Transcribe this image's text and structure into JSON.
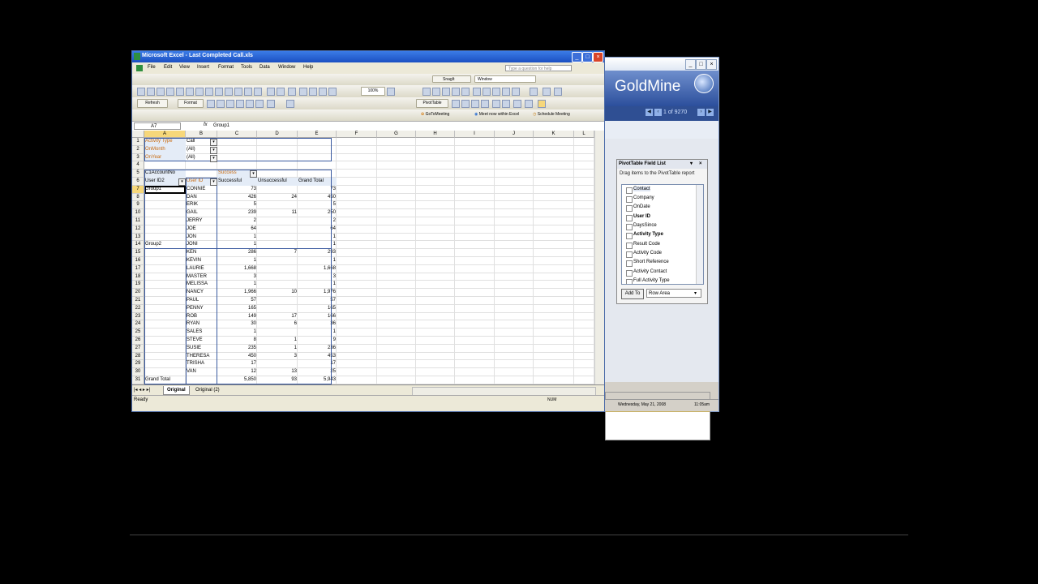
{
  "goldmine": {
    "logo": "GoldMine",
    "record_nav": "1 of 9270",
    "status_date": "Wednesday, May 21, 2008",
    "status_time": "11:05am"
  },
  "pivot_field_list": {
    "title": "PivotTable Field List",
    "hint": "Drag items to the PivotTable report",
    "fields": [
      "Contact",
      "Company",
      "OnDate",
      "User ID",
      "DaysSince",
      "Activity Type",
      "Result Code",
      "Activity Code",
      "Short Reference",
      "Activity Contact",
      "Full Activity Type"
    ],
    "add_to_label": "Add To",
    "area_value": "Row Area"
  },
  "excel": {
    "title": "Microsoft Excel - Last Completed Call.xls",
    "menu": [
      "File",
      "Edit",
      "View",
      "Insert",
      "Format",
      "Tools",
      "Data",
      "Window",
      "Help"
    ],
    "question_placeholder": "Type a question for help",
    "zoom": "100%",
    "snagit_label": "SnagIt",
    "window_label": "Window",
    "refresh_label": "Refresh",
    "format_label": "Format",
    "pivottable_label": "PivotTable",
    "gotomeeting_label": "GoToMeeting",
    "meet_now_label": "Meet now within Excel",
    "schedule_label": "Schedule Meeting",
    "namebox": "A7",
    "formula": "Group1",
    "columns": [
      "A",
      "B",
      "C",
      "D",
      "E",
      "F",
      "G",
      "H",
      "I",
      "J",
      "K",
      "L"
    ],
    "page_fields": [
      {
        "label": "Activity Type",
        "value": "Call"
      },
      {
        "label": "OnMonth",
        "value": "(All)"
      },
      {
        "label": "OnYear",
        "value": "(All)"
      }
    ],
    "row5": {
      "a": "C1AccountNo",
      "c": "Success"
    },
    "row6": {
      "a": "User ID2",
      "b": "User ID",
      "c": "Successful",
      "d": "Unsuccessful",
      "e": "Grand Total"
    },
    "rows": [
      {
        "n": "7",
        "a": "Group1",
        "b": "CONNIE",
        "c": "73",
        "d": "",
        "e": "73"
      },
      {
        "n": "8",
        "a": "",
        "b": "DAN",
        "c": "426",
        "d": "24",
        "e": "450"
      },
      {
        "n": "9",
        "a": "",
        "b": "ERIK",
        "c": "5",
        "d": "",
        "e": "5"
      },
      {
        "n": "10",
        "a": "",
        "b": "GAIL",
        "c": "239",
        "d": "11",
        "e": "250"
      },
      {
        "n": "11",
        "a": "",
        "b": "JERRY",
        "c": "2",
        "d": "",
        "e": "2"
      },
      {
        "n": "12",
        "a": "",
        "b": "JOE",
        "c": "64",
        "d": "",
        "e": "64"
      },
      {
        "n": "13",
        "a": "",
        "b": "JON",
        "c": "1",
        "d": "",
        "e": "1"
      },
      {
        "n": "14",
        "a": "Group2",
        "b": "JONI",
        "c": "1",
        "d": "",
        "e": "1"
      },
      {
        "n": "15",
        "a": "",
        "b": "KEN",
        "c": "286",
        "d": "7",
        "e": "293"
      },
      {
        "n": "16",
        "a": "",
        "b": "KEVIN",
        "c": "1",
        "d": "",
        "e": "1"
      },
      {
        "n": "17",
        "a": "",
        "b": "LAURIE",
        "c": "1,668",
        "d": "",
        "e": "1,668"
      },
      {
        "n": "18",
        "a": "",
        "b": "MASTER",
        "c": "3",
        "d": "",
        "e": "3"
      },
      {
        "n": "19",
        "a": "",
        "b": "MELISSA",
        "c": "1",
        "d": "",
        "e": "1"
      },
      {
        "n": "20",
        "a": "",
        "b": "NANCY",
        "c": "1,966",
        "d": "10",
        "e": "1,976"
      },
      {
        "n": "21",
        "a": "",
        "b": "PAUL",
        "c": "57",
        "d": "",
        "e": "57"
      },
      {
        "n": "22",
        "a": "",
        "b": "PENNY",
        "c": "165",
        "d": "",
        "e": "165"
      },
      {
        "n": "23",
        "a": "",
        "b": "ROB",
        "c": "149",
        "d": "17",
        "e": "166"
      },
      {
        "n": "24",
        "a": "",
        "b": "RYAN",
        "c": "30",
        "d": "6",
        "e": "36"
      },
      {
        "n": "25",
        "a": "",
        "b": "SALES",
        "c": "1",
        "d": "",
        "e": "1"
      },
      {
        "n": "26",
        "a": "",
        "b": "STEVE",
        "c": "8",
        "d": "1",
        "e": "9"
      },
      {
        "n": "27",
        "a": "",
        "b": "SUSIE",
        "c": "235",
        "d": "1",
        "e": "236"
      },
      {
        "n": "28",
        "a": "",
        "b": "THERESA",
        "c": "450",
        "d": "3",
        "e": "453"
      },
      {
        "n": "29",
        "a": "",
        "b": "TRISHA",
        "c": "17",
        "d": "",
        "e": "17"
      },
      {
        "n": "30",
        "a": "",
        "b": "VAN",
        "c": "12",
        "d": "13",
        "e": "25"
      },
      {
        "n": "31",
        "a": "Grand Total",
        "b": "",
        "c": "5,850",
        "d": "93",
        "e": "5,943"
      }
    ],
    "sheet_tabs": [
      "Original",
      "Original (2)"
    ],
    "status": "Ready",
    "num_indicator": "NUM"
  }
}
